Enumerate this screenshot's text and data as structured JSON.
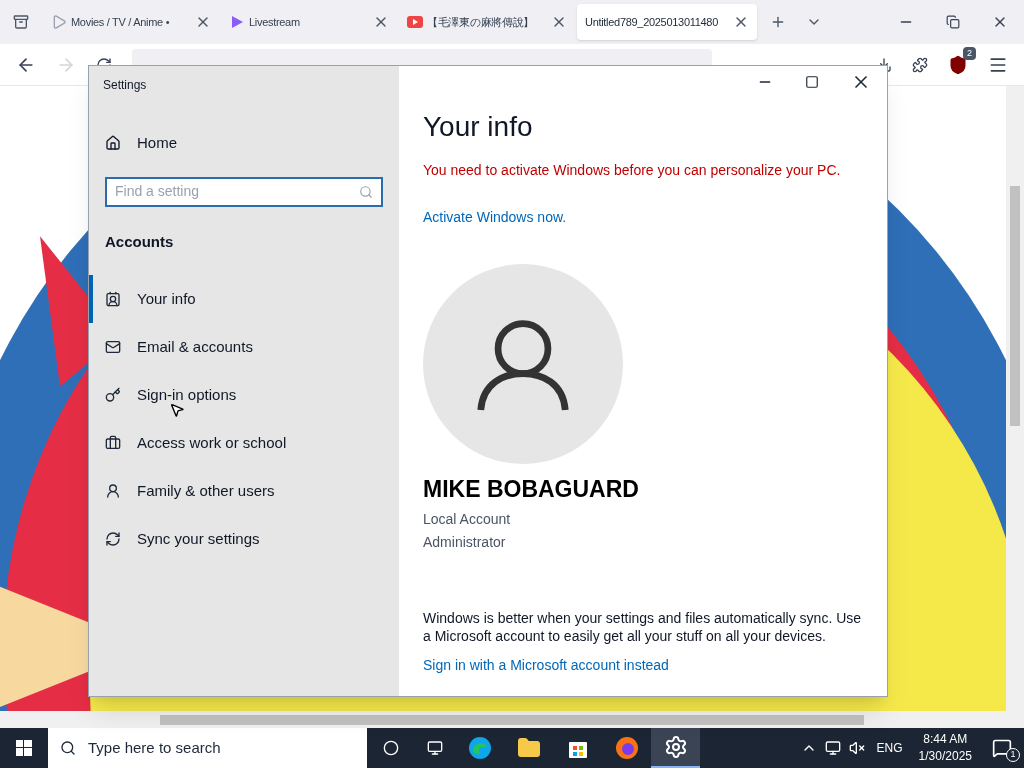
{
  "browser": {
    "tabs": [
      {
        "kind": "video",
        "title": "Movies / TV / Anime •",
        "selected": false
      },
      {
        "kind": "stream",
        "title": "Livestream",
        "selected": false
      },
      {
        "kind": "youtube",
        "title": "【毛澤東の麻將傳說】",
        "selected": false
      },
      {
        "kind": "page",
        "title": "Untitled789_2025013011480",
        "selected": true
      }
    ],
    "extension_badge": "2"
  },
  "settings": {
    "title": "Settings",
    "home": "Home",
    "search": {
      "placeholder": "Find a setting"
    },
    "section": "Accounts",
    "nav": [
      {
        "kind": "info",
        "label": "Your info",
        "selected": true
      },
      {
        "kind": "mail",
        "label": "Email & accounts",
        "selected": false
      },
      {
        "kind": "key",
        "label": "Sign-in options",
        "selected": false
      },
      {
        "kind": "briefcase",
        "label": "Access work or school",
        "selected": false
      },
      {
        "kind": "family",
        "label": "Family & other users",
        "selected": false
      },
      {
        "kind": "sync",
        "label": "Sync your settings",
        "selected": false
      }
    ],
    "page_title": "Your info",
    "warning": "You need to activate Windows before you can personalize your PC.",
    "activate_link": "Activate Windows now.",
    "user": {
      "name": "MIKE BOBAGUARD",
      "account_type": "Local Account",
      "role": "Administrator"
    },
    "sync_note": "Windows is better when your settings and files automatically sync. Use a Microsoft account to easily get all your stuff on all your devices.",
    "microsoft_link": "Sign in with a Microsoft account instead"
  },
  "taskbar": {
    "search_placeholder": "Type here to search",
    "language": "ENG",
    "time": "8:44 AM",
    "date": "1/30/2025",
    "notification_count": "1",
    "apps": [
      {
        "kind": "edge",
        "selected": false
      },
      {
        "kind": "explorer",
        "selected": false
      },
      {
        "kind": "store",
        "selected": false
      },
      {
        "kind": "firefox",
        "selected": false
      },
      {
        "kind": "settings",
        "selected": true
      }
    ]
  }
}
